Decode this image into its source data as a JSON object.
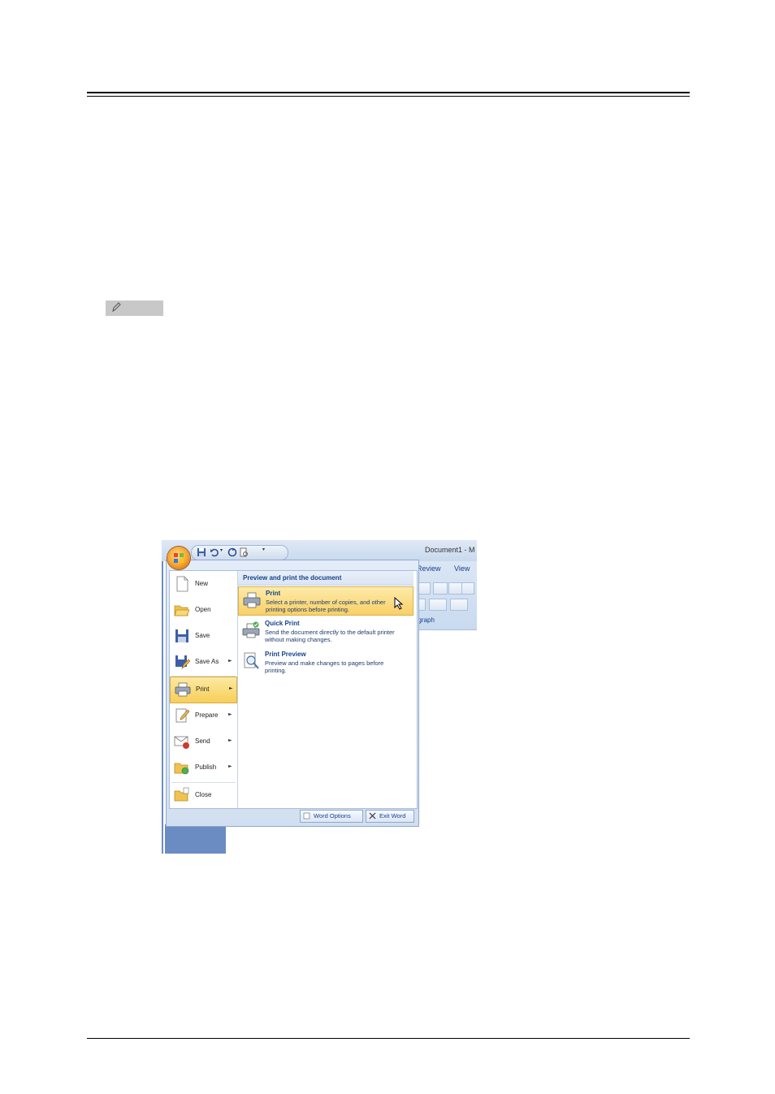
{
  "window": {
    "title": "Document1 - M"
  },
  "ribbon": {
    "tabs": [
      "Review",
      "View"
    ],
    "group_label": "agraph"
  },
  "office_menu": {
    "items": [
      {
        "label": "New",
        "icon": "new-document-icon",
        "has_submenu": false
      },
      {
        "label": "Open",
        "icon": "open-folder-icon",
        "has_submenu": false
      },
      {
        "label": "Save",
        "icon": "save-disk-icon",
        "has_submenu": false
      },
      {
        "label": "Save As",
        "icon": "save-as-icon",
        "has_submenu": true
      },
      {
        "label": "Print",
        "icon": "printer-icon",
        "has_submenu": true,
        "active": true
      },
      {
        "label": "Prepare",
        "icon": "prepare-icon",
        "has_submenu": true
      },
      {
        "label": "Send",
        "icon": "send-icon",
        "has_submenu": true
      },
      {
        "label": "Publish",
        "icon": "publish-icon",
        "has_submenu": true
      },
      {
        "label": "Close",
        "icon": "close-folder-icon",
        "has_submenu": false
      }
    ],
    "submenu": {
      "header": "Preview and print the document",
      "items": [
        {
          "title": "Print",
          "description": "Select a printer, number of copies, and other printing options before printing.",
          "icon": "printer-icon"
        },
        {
          "title": "Quick Print",
          "description": "Send the document directly to the default printer without making changes.",
          "icon": "quick-print-icon"
        },
        {
          "title": "Print Preview",
          "description": "Preview and make changes to pages before printing.",
          "icon": "print-preview-icon"
        }
      ]
    },
    "footer": {
      "word_options": "Word Options",
      "exit_word": "Exit Word"
    }
  },
  "colors": {
    "highlight": "#f8d066",
    "menu_text": "#15428b",
    "left_accent": "#6b8cc2"
  }
}
